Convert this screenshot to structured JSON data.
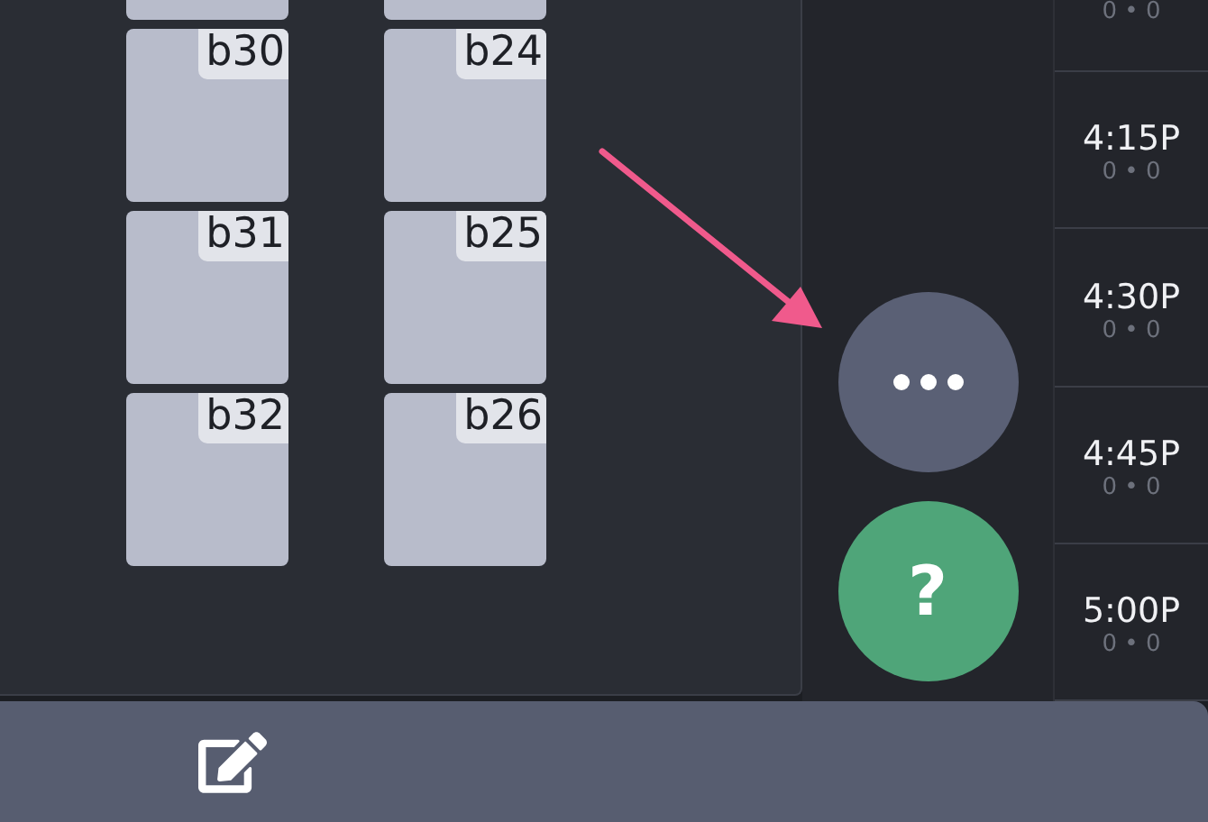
{
  "tile_columns": [
    {
      "tiles": [
        {
          "kind": "clipped"
        },
        {
          "kind": "seat",
          "label": "b30"
        },
        {
          "kind": "seat",
          "label": "b31"
        },
        {
          "kind": "seat",
          "label": "b32"
        }
      ]
    },
    {
      "tiles": [
        {
          "kind": "clipped"
        },
        {
          "kind": "seat",
          "label": "b24"
        },
        {
          "kind": "seat",
          "label": "b25"
        },
        {
          "kind": "seat",
          "label": "b26"
        }
      ]
    }
  ],
  "actions": [
    {
      "kind": "more"
    },
    {
      "kind": "help",
      "label": "?"
    }
  ],
  "time_slots": [
    {
      "count": "0 • 0"
    },
    {
      "time": "4:15P",
      "count": "0 • 0"
    },
    {
      "time": "4:30P",
      "count": "0 • 0"
    },
    {
      "time": "4:45P",
      "count": "0 • 0"
    },
    {
      "time": "5:00P",
      "count": "0 • 0"
    }
  ],
  "bottom_bar": {
    "tools": [
      {
        "kind": "edit"
      }
    ]
  }
}
